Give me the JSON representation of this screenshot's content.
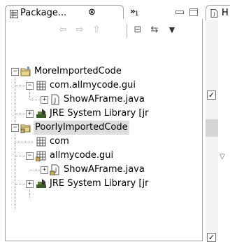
{
  "package_view": {
    "tab_label": "Package...",
    "close_glyph": "⊗",
    "overflow_glyph": "»",
    "overflow_count": "1",
    "icons": {
      "view": "package-explorer-icon",
      "minimize": "minimize-icon",
      "maximize": "maximize-icon"
    }
  },
  "toolbar": {
    "back": "⇦",
    "forward": "⇨",
    "up": "⇧",
    "collapse_all": "⊟",
    "link": "⇆",
    "menu": "▼"
  },
  "tree": [
    {
      "label": "MoreImportedCode",
      "icon": "project-icon",
      "expander": "−",
      "selected": false
    },
    {
      "label": "com.allmycode.gui",
      "icon": "package-icon",
      "expander": "−",
      "selected": false
    },
    {
      "label": "ShowAFrame.java",
      "icon": "java-file-icon",
      "expander": "+",
      "selected": false
    },
    {
      "label": "JRE System Library [jr",
      "icon": "library-icon",
      "expander": "+",
      "selected": false
    },
    {
      "label": "PoorlyImportedCode",
      "icon": "project-icon",
      "expander": "−",
      "selected": true
    },
    {
      "label": "com",
      "icon": "package-icon",
      "expander": "",
      "selected": false
    },
    {
      "label": "allmycode.gui",
      "icon": "package-icon",
      "expander": "−",
      "selected": false
    },
    {
      "label": "ShowAFrame.java",
      "icon": "java-file-icon",
      "expander": "+",
      "selected": false
    },
    {
      "label": "JRE System Library [jr",
      "icon": "library-icon",
      "expander": "+",
      "selected": false
    }
  ],
  "editor": {
    "tab_label": "H",
    "gutter_marker_1": "✓",
    "fold_marker": "▽",
    "gutter_marker_2": "✓"
  }
}
